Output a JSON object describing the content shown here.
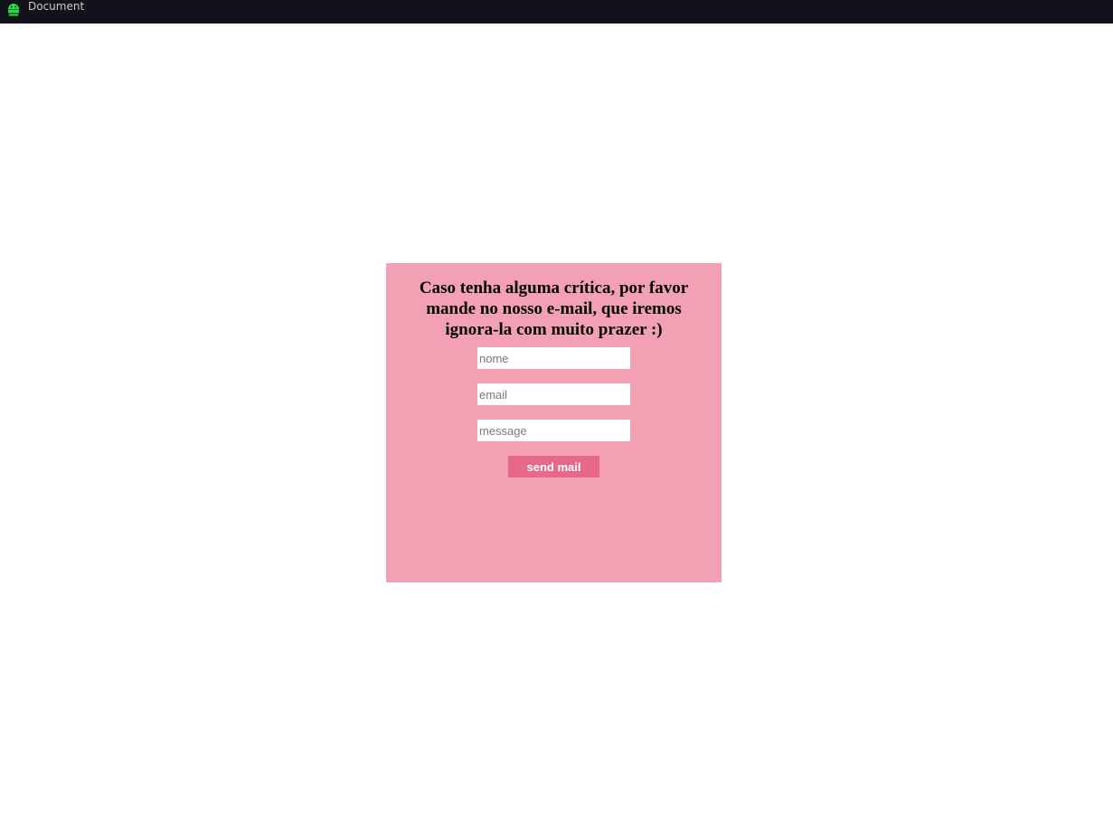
{
  "window": {
    "title": "Document",
    "icon": "android-robot-icon",
    "titlebar_color": "#12121a",
    "icon_color": "#22dd44"
  },
  "form": {
    "heading": "Caso tenha alguma crítica, por favor mande no nosso e-mail, que iremos ignora-la com muito prazer :)",
    "background_color": "#f4a0b4",
    "fields": {
      "name": {
        "placeholder": "nome",
        "value": ""
      },
      "email": {
        "placeholder": "email",
        "value": ""
      },
      "message": {
        "placeholder": "message",
        "value": ""
      }
    },
    "submit": {
      "label": "send mail",
      "color": "#e8688a"
    }
  }
}
